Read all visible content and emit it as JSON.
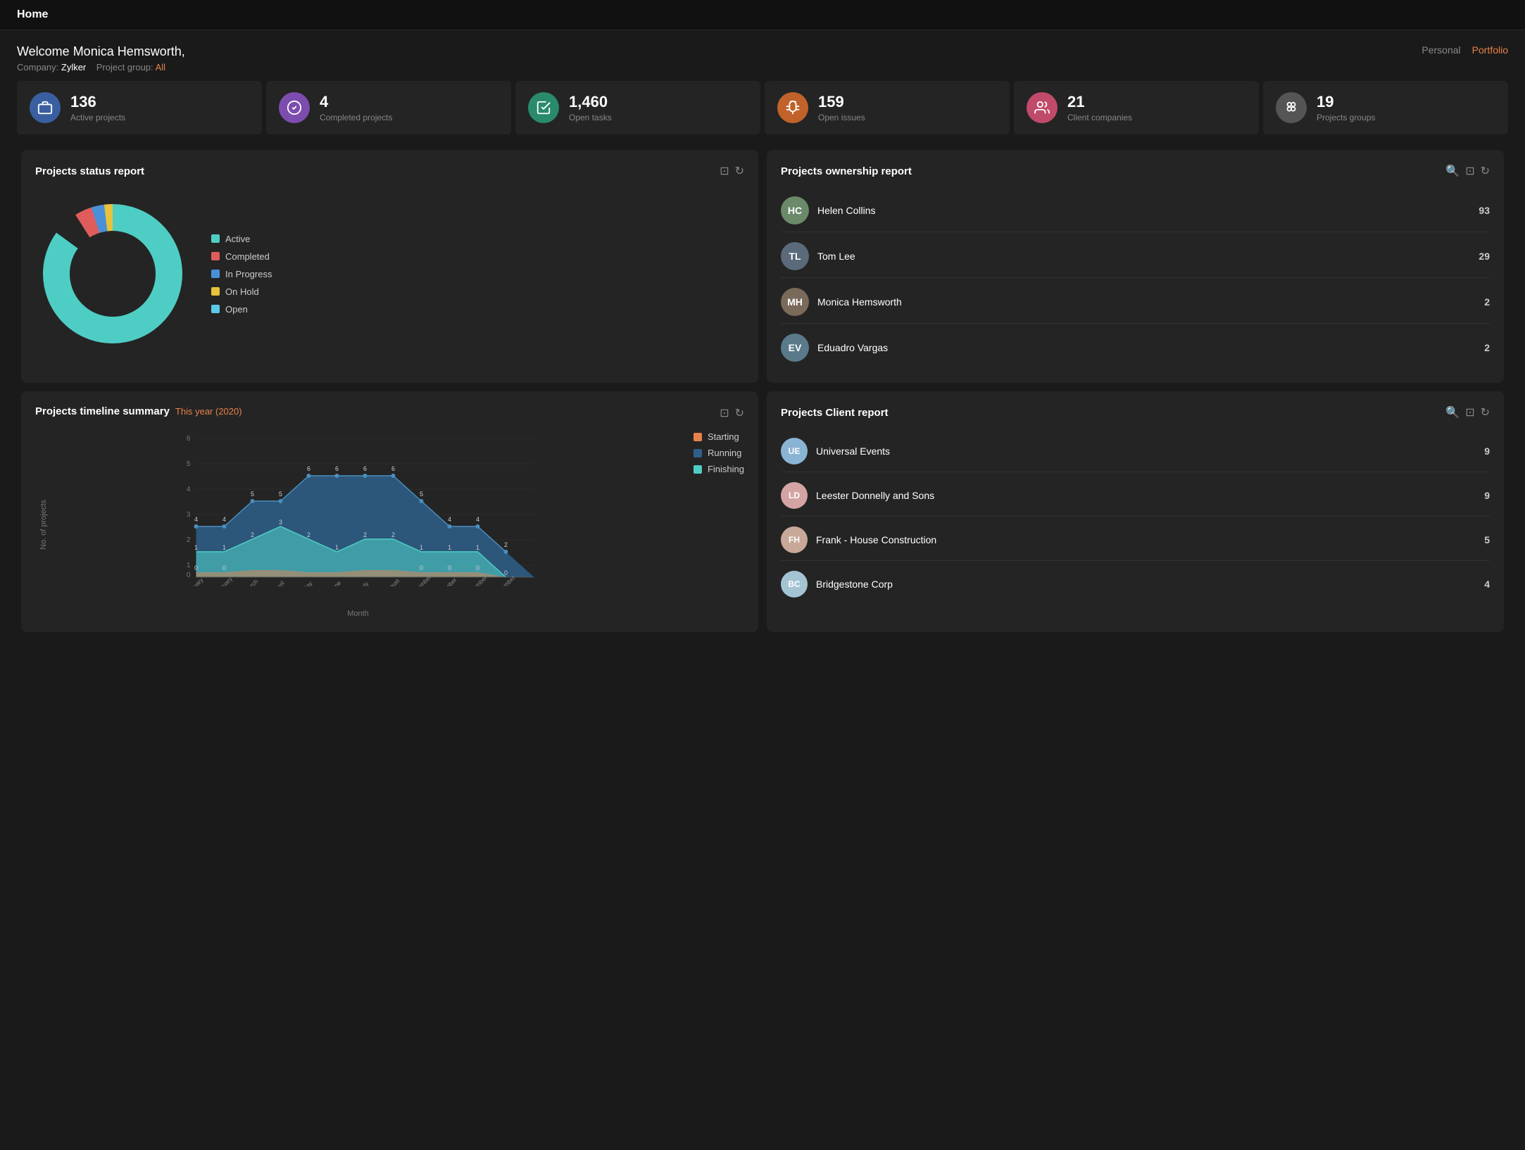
{
  "topbar": {
    "title": "Home"
  },
  "header": {
    "welcome": "Welcome Monica Hemsworth,",
    "company_label": "Company:",
    "company": "Zylker",
    "project_group_label": "Project group:",
    "project_group": "All",
    "view_personal": "Personal",
    "view_portfolio": "Portfolio"
  },
  "stats": [
    {
      "id": "active-projects",
      "number": "136",
      "label": "Active projects",
      "icon": "briefcase",
      "icon_class": "icon-blue"
    },
    {
      "id": "completed-projects",
      "number": "4",
      "label": "Completed projects",
      "icon": "check-circle",
      "icon_class": "icon-purple"
    },
    {
      "id": "open-tasks",
      "number": "1,460",
      "label": "Open tasks",
      "icon": "task",
      "icon_class": "icon-teal"
    },
    {
      "id": "open-issues",
      "number": "159",
      "label": "Open issues",
      "icon": "bug",
      "icon_class": "icon-orange"
    },
    {
      "id": "client-companies",
      "number": "21",
      "label": "Client companies",
      "icon": "users",
      "icon_class": "icon-pink"
    },
    {
      "id": "projects-groups",
      "number": "19",
      "label": "Projects groups",
      "icon": "grid",
      "icon_class": "icon-gray"
    }
  ],
  "status_report": {
    "title": "Projects status report",
    "legend": [
      {
        "label": "Active",
        "color": "#4ecdc4"
      },
      {
        "label": "Completed",
        "color": "#e05c5c"
      },
      {
        "label": "In Progress",
        "color": "#4a90d9"
      },
      {
        "label": "On Hold",
        "color": "#e8c23a"
      },
      {
        "label": "Open",
        "color": "#5bc8e8"
      }
    ],
    "donut": {
      "active_pct": 85,
      "completed_pct": 6,
      "inprogress_pct": 4,
      "onhold_pct": 3,
      "open_pct": 2
    }
  },
  "ownership_report": {
    "title": "Projects ownership report",
    "people": [
      {
        "name": "Helen Collins",
        "count": 93,
        "initials": "HC",
        "color": "#6a8a6a"
      },
      {
        "name": "Tom Lee",
        "count": 29,
        "initials": "TL",
        "color": "#7a7a8a"
      },
      {
        "name": "Monica Hemsworth",
        "count": 2,
        "initials": "MH",
        "color": "#8a7a6a"
      },
      {
        "name": "Eduadro Vargas",
        "count": 2,
        "initials": "EV",
        "color": "#6a7a8a"
      }
    ]
  },
  "timeline": {
    "title": "Projects timeline summary",
    "year": "This year (2020)",
    "y_axis_label": "No. of projects",
    "x_axis_label": "Month",
    "legend": [
      {
        "label": "Starting",
        "color": "#e8824a"
      },
      {
        "label": "Running",
        "color": "#2e5f8a"
      },
      {
        "label": "Finishing",
        "color": "#4ecdc4"
      }
    ],
    "months": [
      "January",
      "February",
      "March",
      "April",
      "May",
      "June",
      "July",
      "August",
      "September",
      "October",
      "November",
      "December"
    ],
    "running": [
      4,
      4,
      5,
      5,
      6,
      6,
      6,
      6,
      5,
      4,
      4,
      2
    ],
    "finishing": [
      1,
      1,
      2,
      3,
      2,
      1,
      2,
      2,
      1,
      1,
      1,
      0
    ],
    "starting": [
      0,
      0,
      0,
      0,
      0,
      0,
      0,
      0,
      0,
      0,
      0,
      0
    ]
  },
  "client_report": {
    "title": "Projects Client report",
    "clients": [
      {
        "name": "Universal Events",
        "count": 9,
        "initials": "UE",
        "color": "#8ab4d4"
      },
      {
        "name": "Leester Donnelly and Sons",
        "count": 9,
        "initials": "LD",
        "color": "#d4a4a4"
      },
      {
        "name": "Frank - House Construction",
        "count": 5,
        "initials": "FH",
        "color": "#d4b4a4"
      },
      {
        "name": "Bridgestone Corp",
        "count": 4,
        "initials": "BC",
        "color": "#a4c4d4"
      }
    ]
  },
  "icons": {
    "refresh": "↻",
    "export": "⊡",
    "search": "🔍"
  }
}
